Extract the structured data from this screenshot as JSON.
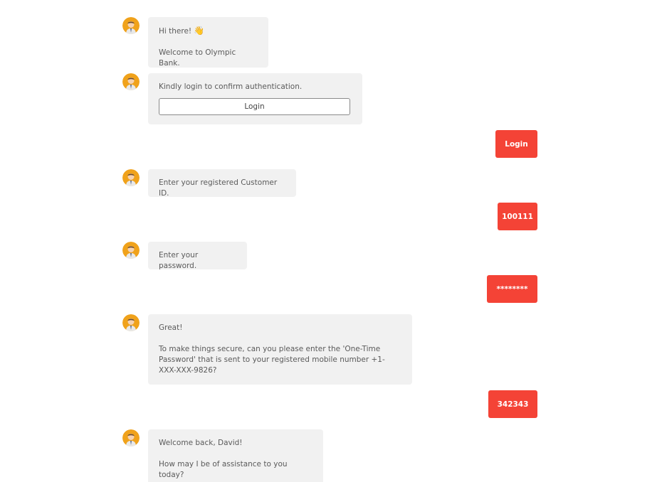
{
  "colors": {
    "bot_bubble": "#f1f1f1",
    "user_bubble": "#f44336",
    "avatar_bg": "#f0a21b"
  },
  "messages": {
    "greeting": {
      "line1": "Hi there!",
      "wave_icon": "👋",
      "line2": "Welcome to Olympic Bank."
    },
    "login_prompt": {
      "text": "Kindly login to confirm authentication.",
      "button_label": "Login"
    },
    "user_login": "Login",
    "customer_id_prompt": "Enter your registered Customer ID.",
    "user_customer_id": "100111",
    "password_prompt": "Enter your password.",
    "user_password": "********",
    "otp_prompt": {
      "line1": "Great!",
      "line2": "To make things secure, can you please enter the 'One-Time Password' that is sent to your registered mobile number +1-XXX-XXX-9826?"
    },
    "user_otp": "342343",
    "welcome_back": {
      "line1": "Welcome back, David!",
      "line2": "How may I be of assistance to you today?"
    }
  }
}
